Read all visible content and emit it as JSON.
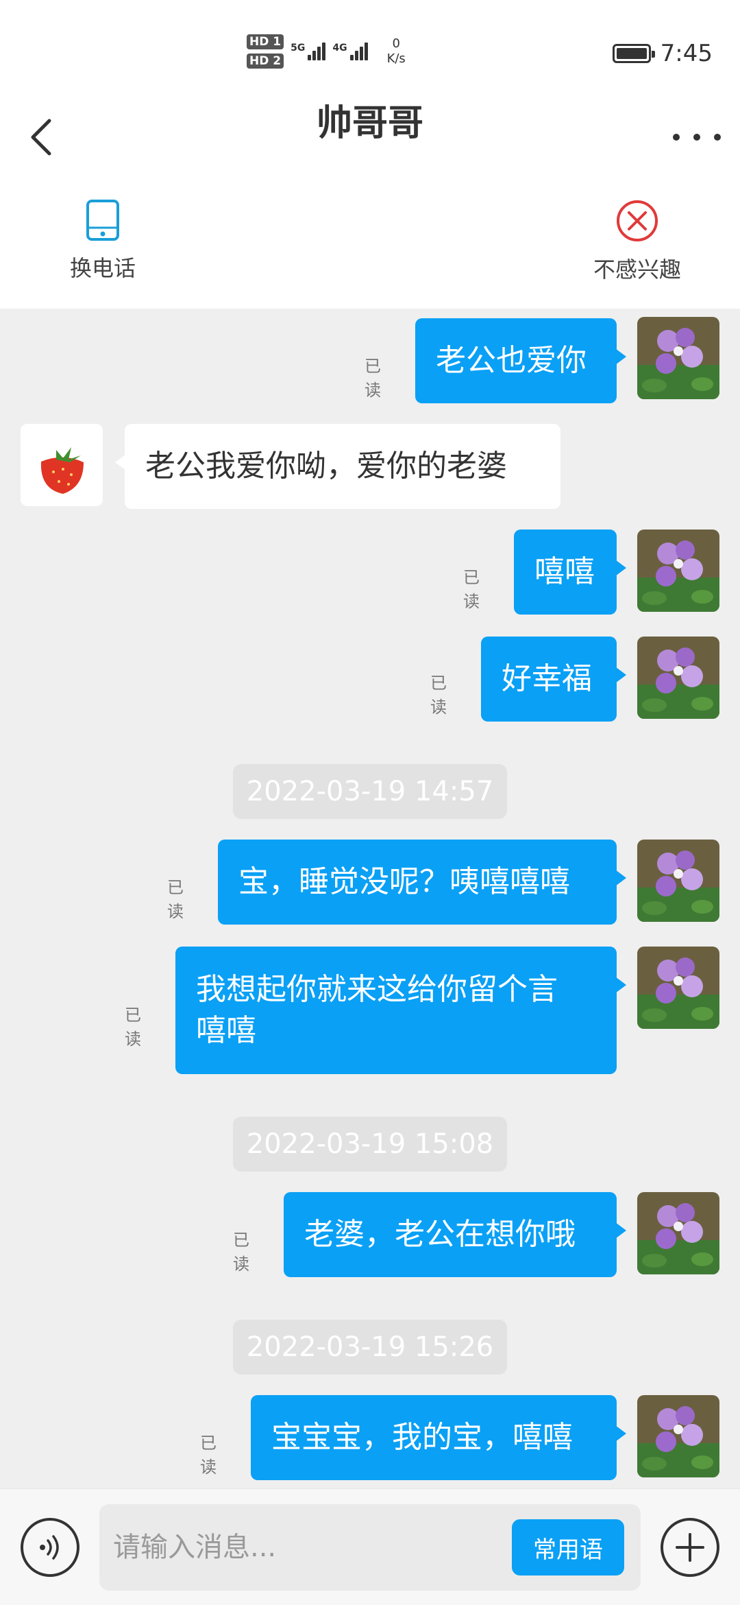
{
  "status_bar": {
    "hd1": "HD 1",
    "hd2": "HD 2",
    "net1": "5G",
    "net2": "4G",
    "speed_value": "0",
    "speed_unit": "K/s",
    "time": "7:45"
  },
  "header": {
    "title": "帅哥哥"
  },
  "actions": {
    "switch_phone": "换电话",
    "not_interested": "不感兴趣"
  },
  "messages": [
    {
      "dir": "out",
      "text": "老公也爱你",
      "read": "已读"
    },
    {
      "dir": "in",
      "text": "老公我爱你呦，爱你的老婆"
    },
    {
      "dir": "out",
      "text": "嘻嘻",
      "read": "已读"
    },
    {
      "dir": "out",
      "text": "好幸福",
      "read": "已读"
    },
    {
      "timestamp": "2022-03-19 14:57"
    },
    {
      "dir": "out",
      "text": "宝，睡觉没呢？咦嘻嘻嘻",
      "read": "已读"
    },
    {
      "dir": "out",
      "text": "我想起你就来这给你留个言嘻嘻",
      "line1": "我想起你就来这给你留个言",
      "line2": "嘻嘻",
      "read": "已读"
    },
    {
      "timestamp": "2022-03-19 15:08"
    },
    {
      "dir": "out",
      "text": "老婆，老公在想你哦",
      "read": "已读"
    },
    {
      "timestamp": "2022-03-19 15:26"
    },
    {
      "dir": "out",
      "text": "宝宝宝，我的宝，嘻嘻",
      "read": "已读"
    }
  ],
  "input": {
    "placeholder": "请输入消息...",
    "phrases_label": "常用语"
  },
  "colors": {
    "accent": "#0aa0f5",
    "chat_bg": "#efefef",
    "decline": "#e03a3a"
  },
  "icons": {
    "back": "back-icon",
    "more": "more-icon",
    "phone": "phone-icon",
    "not_interested": "circle-x-icon",
    "voice": "voice-icon",
    "add": "plus-icon"
  }
}
